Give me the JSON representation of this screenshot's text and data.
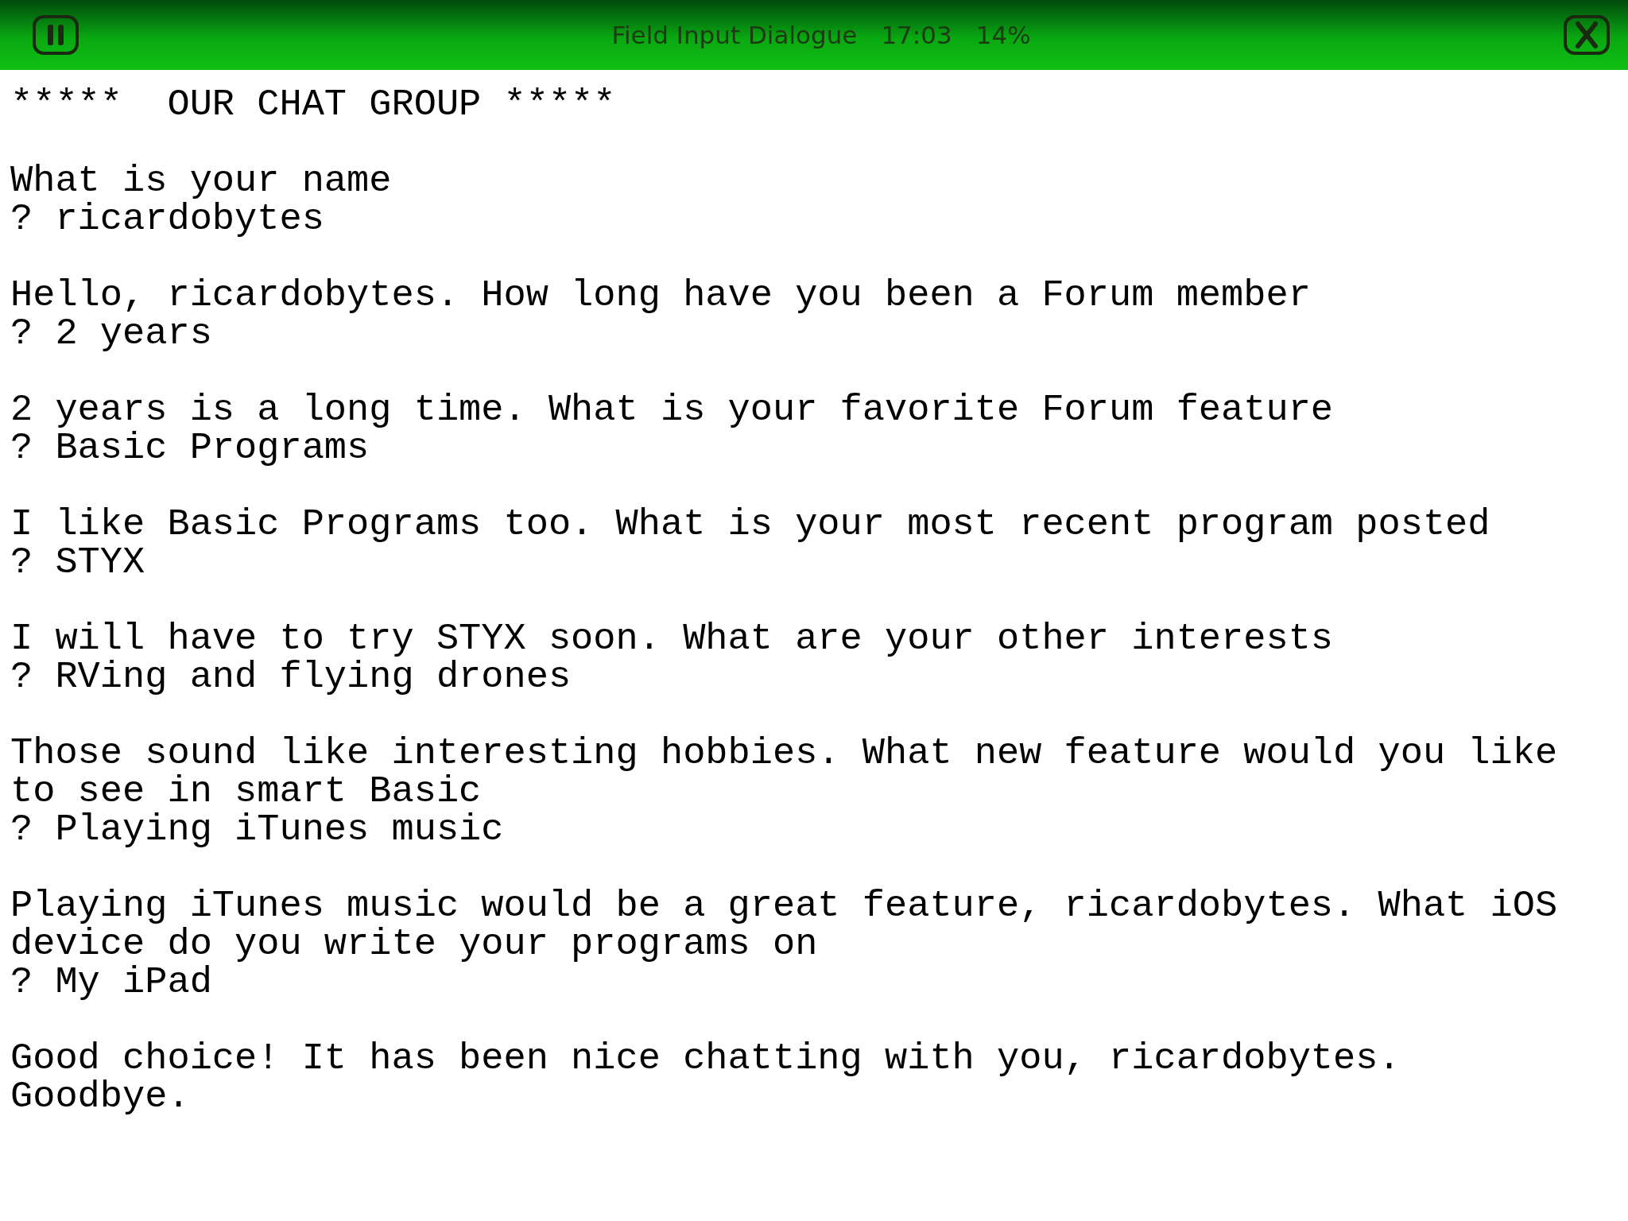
{
  "title_bar": {
    "title": "Field Input Dialogue",
    "time": "17:03",
    "battery": "14%"
  },
  "blocks": [
    {
      "lines": [
        "*****  OUR CHAT GROUP *****"
      ]
    },
    {
      "lines": [
        "What is your name",
        "? ricardobytes"
      ]
    },
    {
      "lines": [
        "Hello, ricardobytes. How long have you been a Forum member",
        "? 2 years"
      ]
    },
    {
      "lines": [
        "2 years is a long time. What is your favorite Forum feature",
        "? Basic Programs"
      ]
    },
    {
      "lines": [
        "I like Basic Programs too. What is your most recent program posted",
        "? STYX"
      ]
    },
    {
      "lines": [
        "I will have to try STYX soon. What are your other interests",
        "? RVing and flying drones"
      ]
    },
    {
      "lines": [
        "Those sound like interesting hobbies. What new feature would you like",
        "to see in smart Basic",
        "? Playing iTunes music"
      ]
    },
    {
      "lines": [
        "Playing iTunes music would be a great feature, ricardobytes. What iOS",
        "device do you write your programs on",
        "? My iPad"
      ]
    },
    {
      "lines": [
        "Good choice! It has been nice chatting with you, ricardobytes.",
        "Goodbye."
      ]
    }
  ]
}
